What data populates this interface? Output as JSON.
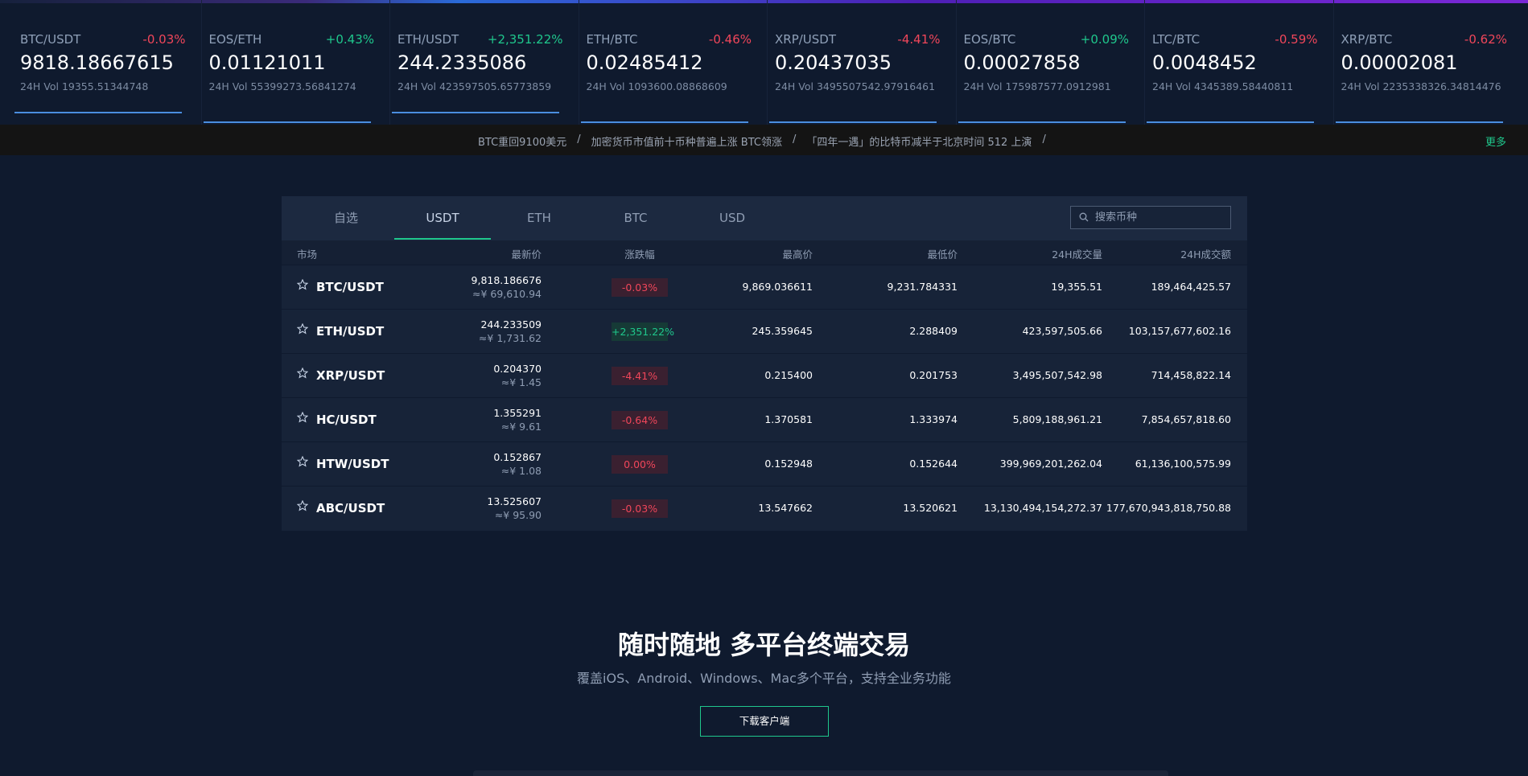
{
  "tickers": [
    {
      "pair": "BTC/USDT",
      "change": "-0.03%",
      "price": "9818.18667615",
      "vol": "24H Vol 19355.51344748",
      "dir": "neg"
    },
    {
      "pair": "EOS/ETH",
      "change": "+0.43%",
      "price": "0.01121011",
      "vol": "24H Vol 55399273.56841274",
      "dir": "pos"
    },
    {
      "pair": "ETH/USDT",
      "change": "+2,351.22%",
      "price": "244.2335086",
      "vol": "24H Vol 423597505.65773859",
      "dir": "pos"
    },
    {
      "pair": "ETH/BTC",
      "change": "-0.46%",
      "price": "0.02485412",
      "vol": "24H Vol 1093600.08868609",
      "dir": "neg"
    },
    {
      "pair": "XRP/USDT",
      "change": "-4.41%",
      "price": "0.20437035",
      "vol": "24H Vol 3495507542.97916461",
      "dir": "neg"
    },
    {
      "pair": "EOS/BTC",
      "change": "+0.09%",
      "price": "0.00027858",
      "vol": "24H Vol 175987577.0912981",
      "dir": "pos"
    },
    {
      "pair": "LTC/BTC",
      "change": "-0.59%",
      "price": "0.0048452",
      "vol": "24H Vol 4345389.58440811",
      "dir": "neg"
    },
    {
      "pair": "XRP/BTC",
      "change": "-0.62%",
      "price": "0.00002081",
      "vol": "24H Vol 2235338326.34814476",
      "dir": "neg"
    }
  ],
  "news": {
    "items": [
      "BTC重回9100美元",
      "加密货币市值前十币种普遍上涨 BTC领涨",
      "「四年一遇」的比特币减半于北京时间 512 上演"
    ],
    "separator": "/",
    "more": "更多"
  },
  "market": {
    "tabs": [
      "自选",
      "USDT",
      "ETH",
      "BTC",
      "USD"
    ],
    "active_tab": "USDT",
    "search_placeholder": "搜索币种",
    "headers": {
      "market": "市场",
      "last": "最新价",
      "change": "涨跌幅",
      "high": "最高价",
      "low": "最低价",
      "volume": "24H成交量",
      "amount": "24H成交额"
    },
    "rows": [
      {
        "pair": "BTC/USDT",
        "last": "9,818.186676",
        "cny": "≈¥ 69,610.94",
        "change": "-0.03%",
        "dir": "neg",
        "high": "9,869.036611",
        "low": "9,231.784331",
        "volume": "19,355.51",
        "amount": "189,464,425.57"
      },
      {
        "pair": "ETH/USDT",
        "last": "244.233509",
        "cny": "≈¥ 1,731.62",
        "change": "+2,351.22%",
        "dir": "pos",
        "high": "245.359645",
        "low": "2.288409",
        "volume": "423,597,505.66",
        "amount": "103,157,677,602.16"
      },
      {
        "pair": "XRP/USDT",
        "last": "0.204370",
        "cny": "≈¥ 1.45",
        "change": "-4.41%",
        "dir": "neg",
        "high": "0.215400",
        "low": "0.201753",
        "volume": "3,495,507,542.98",
        "amount": "714,458,822.14"
      },
      {
        "pair": "HC/USDT",
        "last": "1.355291",
        "cny": "≈¥ 9.61",
        "change": "-0.64%",
        "dir": "neg",
        "high": "1.370581",
        "low": "1.333974",
        "volume": "5,809,188,961.21",
        "amount": "7,854,657,818.60"
      },
      {
        "pair": "HTW/USDT",
        "last": "0.152867",
        "cny": "≈¥ 1.08",
        "change": "0.00%",
        "dir": "neg",
        "high": "0.152948",
        "low": "0.152644",
        "volume": "399,969,201,262.04",
        "amount": "61,136,100,575.99"
      },
      {
        "pair": "ABC/USDT",
        "last": "13.525607",
        "cny": "≈¥ 95.90",
        "change": "-0.03%",
        "dir": "neg",
        "high": "13.547662",
        "low": "13.520621",
        "volume": "13,130,494,154,272.37",
        "amount": "177,670,943,818,750.88"
      }
    ]
  },
  "promo": {
    "title": "随时随地 多平台终端交易",
    "subtitle": "覆盖iOS、Android、Windows、Mac多个平台，支持全业务功能",
    "download_label": "下载客户端"
  },
  "colors": {
    "negative": "#f0465a",
    "positive": "#1fc78c",
    "background": "#0f1a2e",
    "accent": "#1fc78c"
  }
}
